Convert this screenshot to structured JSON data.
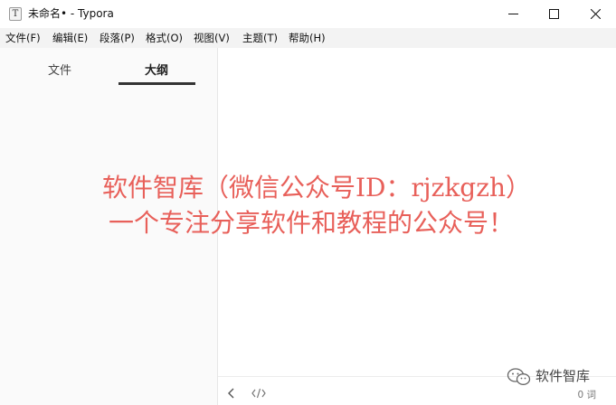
{
  "window": {
    "title": "未命名• - Typora",
    "app_icon_letter": "T"
  },
  "menubar": {
    "items": [
      {
        "label": "文件(F)"
      },
      {
        "label": "编辑(E)"
      },
      {
        "label": "段落(P)"
      },
      {
        "label": "格式(O)"
      },
      {
        "label": "视图(V)"
      },
      {
        "label": "主题(T)"
      },
      {
        "label": "帮助(H)"
      }
    ]
  },
  "sidebar": {
    "tabs": [
      {
        "label": "文件"
      },
      {
        "label": "大纲",
        "active": true
      }
    ]
  },
  "statusbar": {
    "word_count": "0 词"
  },
  "overlay": {
    "line1": "软件智库（微信公众号ID：rjzkgzh）",
    "line2": "一个专注分享软件和教程的公众号！",
    "color": "#e8605a"
  },
  "watermark": {
    "icon": "wechat-icon",
    "text": "软件智库"
  }
}
